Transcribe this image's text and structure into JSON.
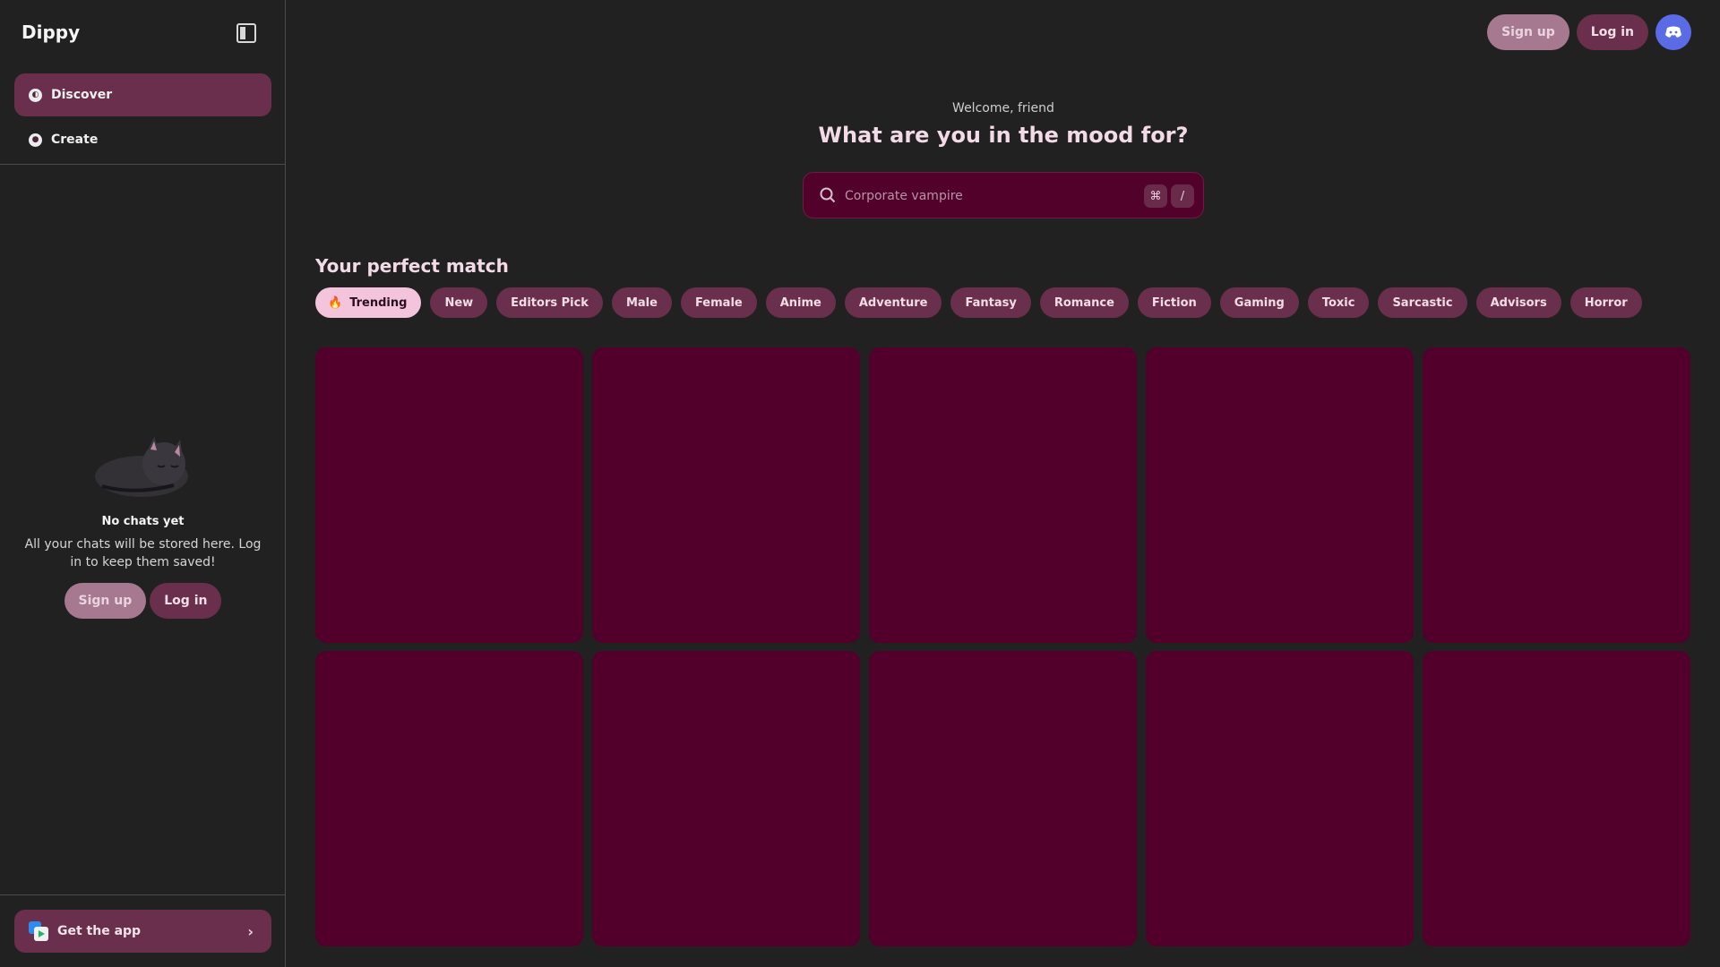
{
  "brand": "Dippy",
  "sidebar": {
    "nav": [
      {
        "label": "Discover",
        "icon": "compass-icon"
      },
      {
        "label": "Create",
        "icon": "palette-icon"
      }
    ],
    "empty_state": {
      "title": "No chats yet",
      "description": "All your chats will be stored here. Log in to keep them saved!",
      "signup_label": "Sign up",
      "login_label": "Log in"
    },
    "get_app_label": "Get the app"
  },
  "header": {
    "signup_label": "Sign up",
    "login_label": "Log in",
    "discord_icon": "discord-icon"
  },
  "main": {
    "welcome": "Welcome, friend",
    "headline": "What are you in the mood for?",
    "search": {
      "placeholder": "Corporate vampire",
      "shortcut_cmd": "⌘",
      "shortcut_key": "/"
    },
    "section_title": "Your perfect match",
    "categories": [
      "Trending",
      "New",
      "Editors Pick",
      "Male",
      "Female",
      "Anime",
      "Adventure",
      "Fantasy",
      "Romance",
      "Fiction",
      "Gaming",
      "Toxic",
      "Sarcastic",
      "Advisors",
      "Horror"
    ],
    "active_category": "Trending",
    "cards_count": 10
  },
  "colors": {
    "background": "#212121",
    "accent": "#6a2f4c",
    "card": "#52002b",
    "active_chip": "#f4c4dc",
    "discord": "#5a6be5"
  }
}
